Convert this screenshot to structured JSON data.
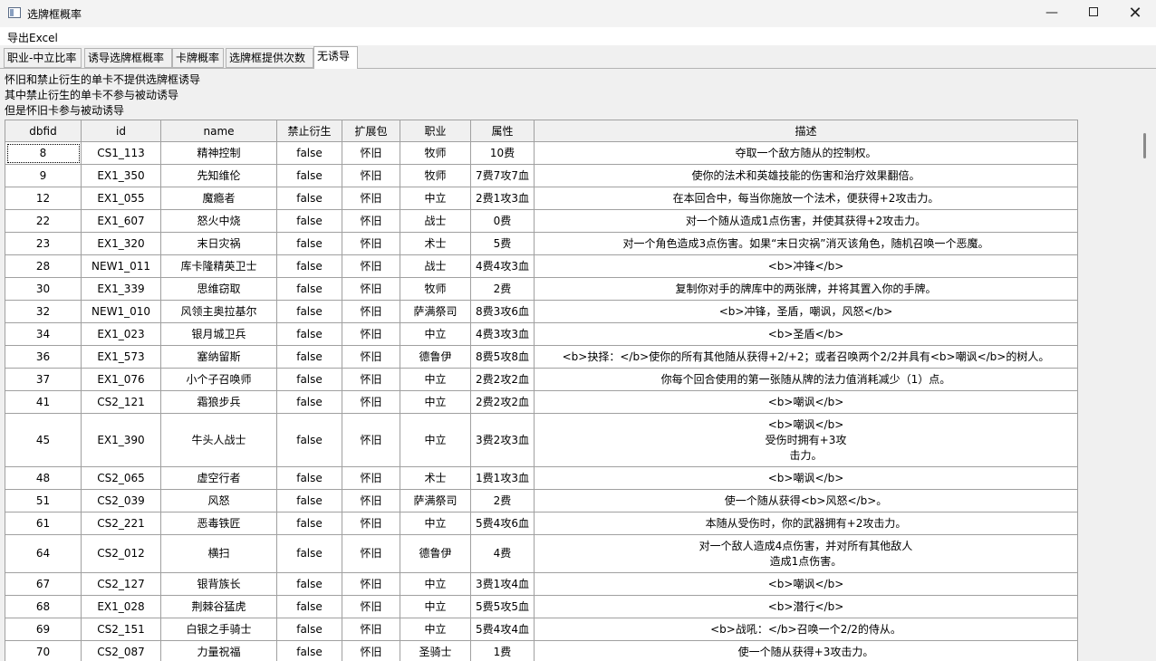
{
  "window": {
    "title": "选牌框概率",
    "minimize": "—",
    "close": "✕"
  },
  "menu": {
    "export": "导出Excel"
  },
  "tabs": [
    "职业-中立比率",
    "诱导选牌框概率",
    "卡牌概率",
    "选牌框提供次数",
    "无诱导"
  ],
  "active_tab": 4,
  "notes": [
    "怀旧和禁止衍生的单卡不提供选牌框诱导",
    "其中禁止衍生的单卡不参与被动诱导",
    "但是怀旧卡参与被动诱导"
  ],
  "table": {
    "columns": [
      "dbfid",
      "id",
      "name",
      "禁止衍生",
      "扩展包",
      "职业",
      "属性",
      "描述"
    ],
    "rows": [
      [
        "8",
        "CS1_113",
        "精神控制",
        "false",
        "怀旧",
        "牧师",
        "10费",
        "夺取一个敌方随从的控制权。"
      ],
      [
        "9",
        "EX1_350",
        "先知维伦",
        "false",
        "怀旧",
        "牧师",
        "7费7攻7血",
        "使你的法术和英雄技能的伤害和治疗效果翻倍。"
      ],
      [
        "12",
        "EX1_055",
        "魔瘾者",
        "false",
        "怀旧",
        "中立",
        "2费1攻3血",
        "在本回合中，每当你施放一个法术，便获得+2攻击力。"
      ],
      [
        "22",
        "EX1_607",
        "怒火中烧",
        "false",
        "怀旧",
        "战士",
        "0费",
        "对一个随从造成1点伤害，并使其获得+2攻击力。"
      ],
      [
        "23",
        "EX1_320",
        "末日灾祸",
        "false",
        "怀旧",
        "术士",
        "5费",
        "对一个角色造成3点伤害。如果“末日灾祸”消灭该角色，随机召唤一个恶魔。"
      ],
      [
        "28",
        "NEW1_011",
        "库卡隆精英卫士",
        "false",
        "怀旧",
        "战士",
        "4费4攻3血",
        "<b>冲锋</b>"
      ],
      [
        "30",
        "EX1_339",
        "思维窃取",
        "false",
        "怀旧",
        "牧师",
        "2费",
        "复制你对手的牌库中的两张牌，并将其置入你的手牌。"
      ],
      [
        "32",
        "NEW1_010",
        "风领主奥拉基尔",
        "false",
        "怀旧",
        "萨满祭司",
        "8费3攻6血",
        "<b>冲锋，圣盾，嘲讽，风怒</b>"
      ],
      [
        "34",
        "EX1_023",
        "银月城卫兵",
        "false",
        "怀旧",
        "中立",
        "4费3攻3血",
        "<b>圣盾</b>"
      ],
      [
        "36",
        "EX1_573",
        "塞纳留斯",
        "false",
        "怀旧",
        "德鲁伊",
        "8费5攻8血",
        "<b>抉择：</b>使你的所有其他随从获得+2/+2；或者召唤两个2/2并具有<b>嘲讽</b>的树人。"
      ],
      [
        "37",
        "EX1_076",
        "小个子召唤师",
        "false",
        "怀旧",
        "中立",
        "2费2攻2血",
        "你每个回合使用的第一张随从牌的法力值消耗减少（1）点。"
      ],
      [
        "41",
        "CS2_121",
        "霜狼步兵",
        "false",
        "怀旧",
        "中立",
        "2费2攻2血",
        "<b>嘲讽</b>"
      ],
      [
        "45",
        "EX1_390",
        "牛头人战士",
        "false",
        "怀旧",
        "中立",
        "3费2攻3血",
        "<b>嘲讽</b>\n受伤时拥有+3攻\n击力。"
      ],
      [
        "48",
        "CS2_065",
        "虚空行者",
        "false",
        "怀旧",
        "术士",
        "1费1攻3血",
        "<b>嘲讽</b>"
      ],
      [
        "51",
        "CS2_039",
        "风怒",
        "false",
        "怀旧",
        "萨满祭司",
        "2费",
        "使一个随从获得<b>风怒</b>。"
      ],
      [
        "61",
        "CS2_221",
        "恶毒铁匠",
        "false",
        "怀旧",
        "中立",
        "5费4攻6血",
        "本随从受伤时，你的武器拥有+2攻击力。"
      ],
      [
        "64",
        "CS2_012",
        "横扫",
        "false",
        "怀旧",
        "德鲁伊",
        "4费",
        "对一个敌人造成4点伤害，并对所有其他敌人\n造成1点伤害。"
      ],
      [
        "67",
        "CS2_127",
        "银背族长",
        "false",
        "怀旧",
        "中立",
        "3费1攻4血",
        "<b>嘲讽</b>"
      ],
      [
        "68",
        "EX1_028",
        "荆棘谷猛虎",
        "false",
        "怀旧",
        "中立",
        "5费5攻5血",
        "<b>潜行</b>"
      ],
      [
        "69",
        "CS2_151",
        "白银之手骑士",
        "false",
        "怀旧",
        "中立",
        "5费4攻4血",
        "<b>战吼：</b>召唤一个2/2的侍从。"
      ],
      [
        "70",
        "CS2_087",
        "力量祝福",
        "false",
        "怀旧",
        "圣骑士",
        "1费",
        "使一个随从获得+3攻击力。"
      ]
    ]
  }
}
